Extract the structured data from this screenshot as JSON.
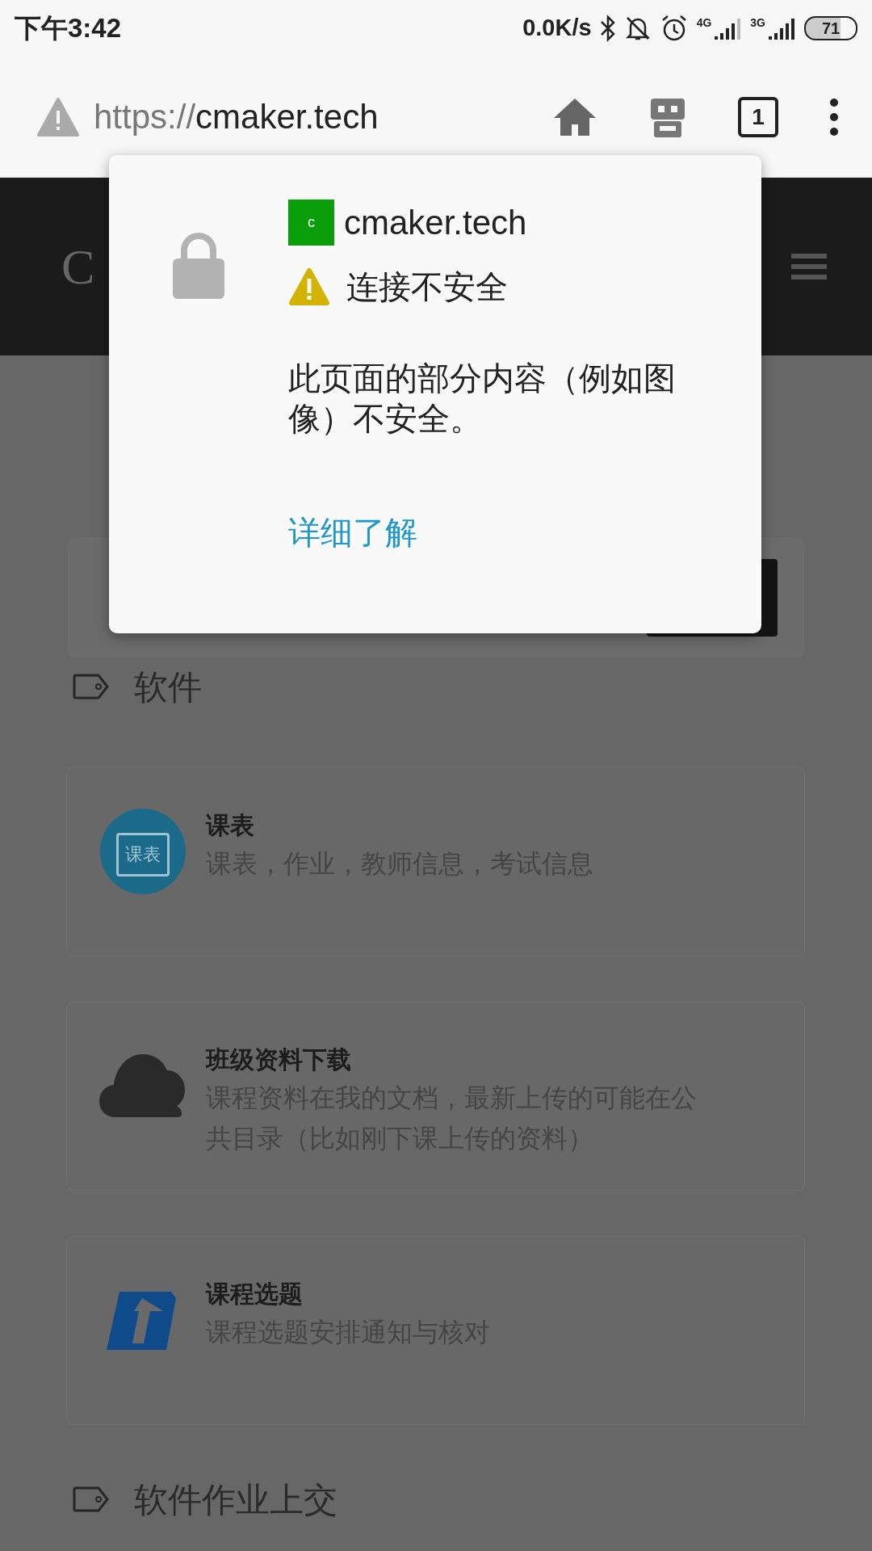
{
  "status_bar": {
    "time": "下午3:42",
    "net_speed": "0.0K/s",
    "network_1": "4G",
    "network_2": "3G",
    "battery": "71"
  },
  "browser": {
    "url_scheme": "https://",
    "url_host": "cmaker.tech",
    "tab_count": "1"
  },
  "site_header": {
    "logo": "C"
  },
  "sections": [
    {
      "title": "软件",
      "cards": [
        {
          "kind": "calendar",
          "icon_text": "课表",
          "title": "课表",
          "description": "课表，作业，教师信息，考试信息"
        },
        {
          "kind": "cloud",
          "title": "班级资料下载",
          "description": "课程资料在我的文档，最新上传的可能在公共目录（比如刚下课上传的资料）"
        },
        {
          "kind": "arrow",
          "title": "课程选题",
          "description": "课程选题安排通知与核对"
        }
      ]
    },
    {
      "title": "软件作业上交"
    }
  ],
  "popup": {
    "favicon_letter": "c",
    "site": "cmaker.tech",
    "status": "连接不安全",
    "message": "此页面的部分内容（例如图像）不安全。",
    "link": "详细了解"
  }
}
